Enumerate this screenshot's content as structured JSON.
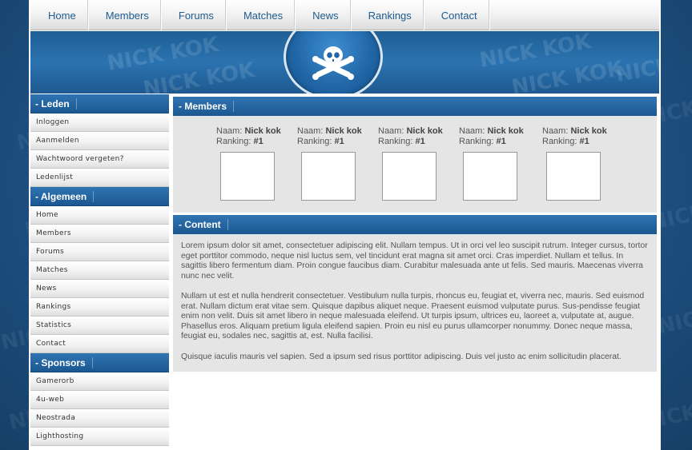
{
  "watermark_text": "NICK KOK",
  "nav": [
    "Home",
    "Members",
    "Forums",
    "Matches",
    "News",
    "Rankings",
    "Contact"
  ],
  "banner": {
    "logo": "skull-crossbones-icon",
    "watermark": "NICK KOK"
  },
  "sidebar": [
    {
      "title": "- Leden",
      "items": [
        "Inloggen",
        "Aanmelden",
        "Wachtwoord vergeten?",
        "Ledenlijst"
      ]
    },
    {
      "title": "- Algemeen",
      "items": [
        "Home",
        "Members",
        "Forums",
        "Matches",
        "News",
        "Rankings",
        "Statistics",
        "Contact"
      ]
    },
    {
      "title": "- Sponsors",
      "items": [
        "Gamerorb",
        "4u-web",
        "Neostrada",
        "Lighthosting"
      ]
    }
  ],
  "members": {
    "title": "- Members",
    "naam_label": "Naam:",
    "ranking_label": "Ranking:",
    "list": [
      {
        "name": "Nick kok",
        "rank": "#1"
      },
      {
        "name": "Nick kok",
        "rank": "#1"
      },
      {
        "name": "Nick kok",
        "rank": "#1"
      },
      {
        "name": "Nick kok",
        "rank": "#1"
      },
      {
        "name": "Nick kok",
        "rank": "#1"
      }
    ]
  },
  "content": {
    "title": "- Content",
    "paragraphs": [
      "Lorem ipsum dolor sit amet, consectetuer adipiscing elit. Nullam tempus. Ut in orci vel leo suscipit rutrum. Integer cursus, tortor eget porttitor commodo, neque nisl luctus sem, vel tincidunt erat magna sit amet orci. Cras imperdiet. Nullam et tellus. In sagittis libero fermentum diam. Proin congue faucibus diam. Curabitur malesuada ante ut felis. Sed mauris. Maecenas viverra nunc nec velit.",
      "Nullam ut est et nulla hendrerit consectetuer. Vestibulum nulla turpis, rhoncus eu, feugiat et, viverra nec, mauris. Sed euismod erat. Nullam dictum erat vitae sem. Quisque dapibus aliquet neque. Praesent euismod vulputate purus. Sus-pendisse feugiat enim non velit. Duis sit amet libero in neque malesuada eleifend. Ut turpis ipsum, ultrices eu, laoreet a, vulputate at, augue. Phasellus eros. Aliquam pretium ligula eleifend sapien. Proin eu nisl eu purus ullamcorper nonummy. Donec neque massa, feugiat eu, sodales nec, sagittis at, est. Nulla facilisi.",
      "Quisque iaculis mauris vel sapien. Sed a ipsum sed risus porttitor adipiscing. Duis vel justo ac enim sollicitudin placerat."
    ]
  },
  "colors": {
    "accent": "#1c5891",
    "nav_text": "#1e5b8f",
    "panel_bg": "#e5e5e5"
  }
}
